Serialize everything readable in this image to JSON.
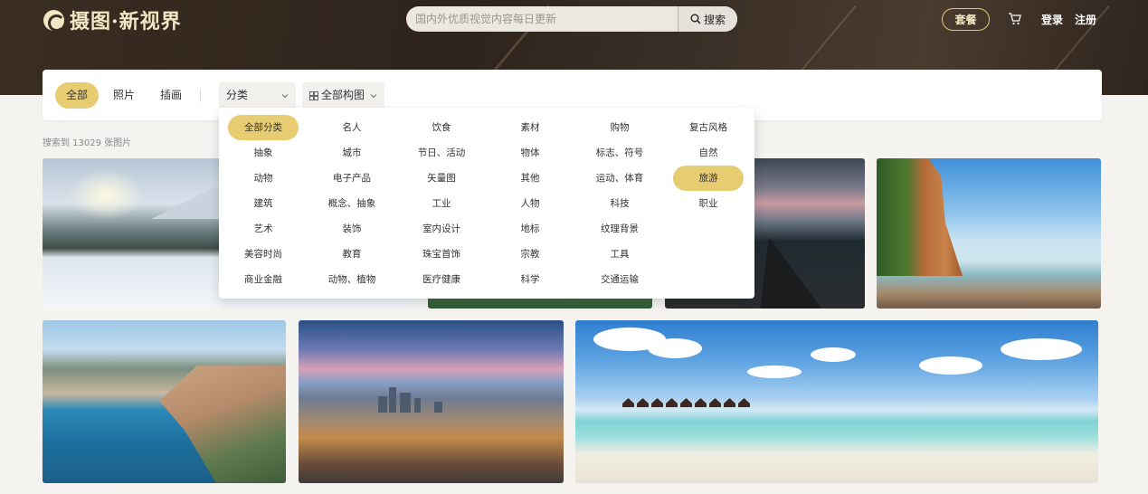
{
  "header": {
    "logo_text": "摄图·新视界",
    "search": {
      "placeholder": "国内外优质视觉内容每日更新",
      "button_label": "搜索"
    },
    "plan_label": "套餐",
    "login_label": "登录",
    "register_label": "注册"
  },
  "filters": {
    "tabs": [
      "全部",
      "照片",
      "插画"
    ],
    "active_tab": "全部",
    "category_select": "分类",
    "composition_select": "全部构图"
  },
  "result_count": "搜索到 13029 张图片",
  "category_dropdown": {
    "selected": [
      "全部分类",
      "旅游"
    ],
    "rows": [
      [
        "全部分类",
        "名人",
        "饮食",
        "素材",
        "购物",
        "复古风格"
      ],
      [
        "抽象",
        "城市",
        "节日、活动",
        "物体",
        "标志、符号",
        "自然"
      ],
      [
        "动物",
        "电子产品",
        "矢量图",
        "其他",
        "运动、体育",
        "旅游"
      ],
      [
        "建筑",
        "概念、抽象",
        "工业",
        "人物",
        "科技",
        "职业"
      ],
      [
        "艺术",
        "装饰",
        "室内设计",
        "地标",
        "纹理背景",
        ""
      ],
      [
        "美容时尚",
        "教育",
        "珠宝首饰",
        "宗教",
        "工具",
        ""
      ],
      [
        "商业金融",
        "动物、植物",
        "医疗健康",
        "科学",
        "交通运输",
        ""
      ]
    ]
  },
  "photos": [
    "snowy-forest",
    "coastal-cliffs",
    "mountain-road",
    "beach-cliff",
    "nice-coastline",
    "city-skyline",
    "tropical-island"
  ],
  "colors": {
    "accent": "#e8cc72",
    "header_bg": "#3a2d22",
    "logo": "#f3e6c4"
  }
}
